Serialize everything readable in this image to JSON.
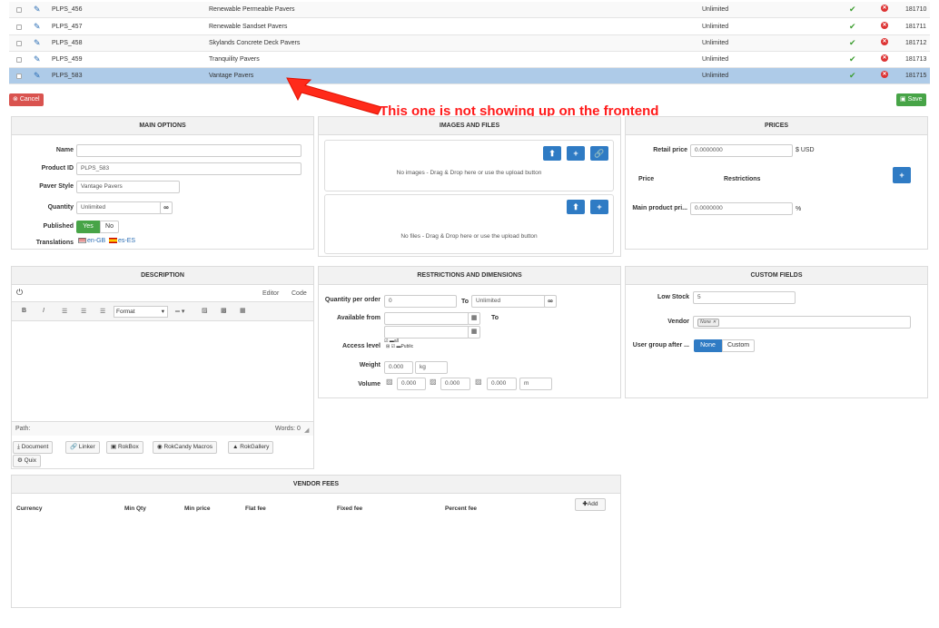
{
  "rows": [
    {
      "id": "PLPS_456",
      "name": "Renewable Permeable Pavers",
      "quantity": "Unlimited",
      "record": "181710"
    },
    {
      "id": "PLPS_457",
      "name": "Renewable Sandset Pavers",
      "quantity": "Unlimited",
      "record": "181711"
    },
    {
      "id": "PLPS_458",
      "name": "Skylands Concrete Deck Pavers",
      "quantity": "Unlimited",
      "record": "181712"
    },
    {
      "id": "PLPS_459",
      "name": "Tranquility Pavers",
      "quantity": "Unlimited",
      "record": "181713"
    },
    {
      "id": "PLPS_583",
      "name": "Vantage Pavers",
      "quantity": "Unlimited",
      "record": "181715"
    }
  ],
  "toolbar": {
    "cancel_label": "Cancel",
    "save_label": "Save"
  },
  "annotation": {
    "text": "This one is not showing up on the frontend",
    "color": "#ff1a1a"
  },
  "main_options": {
    "title": "MAIN OPTIONS",
    "name_label": "Name",
    "name_value": "",
    "product_id_label": "Product ID",
    "product_id_value": "PLPS_583",
    "style_label": "Paver Style",
    "style_value": "Vantage Pavers",
    "quantity_label": "Quantity",
    "quantity_value": "Unlimited",
    "published_label": "Published",
    "yes": "Yes",
    "no": "No",
    "translations_label": "Translations",
    "lang1": "en-GB",
    "lang2": "es-ES"
  },
  "images": {
    "title": "IMAGES AND FILES",
    "no_images": "No images - Drag & Drop here or use the upload button",
    "no_files": "No files - Drag & Drop here or use the upload button"
  },
  "prices": {
    "title": "PRICES",
    "retail_label": "Retail price",
    "retail_value": "0.0000000",
    "currency": "$ USD",
    "price_col": "Price",
    "restrictions_col": "Restrictions",
    "main_label": "Main product pri...",
    "main_value": "0.0000000",
    "percent": "%"
  },
  "description": {
    "title": "DESCRIPTION",
    "tab_editor": "Editor",
    "tab_code": "Code",
    "format_label": "Format",
    "path_label": "Path:",
    "words_label": "Words: 0",
    "buttons": [
      "Document",
      "Linker",
      "RokBox",
      "RokCandy Macros",
      "RokGallery",
      "Quix"
    ]
  },
  "restrictions": {
    "title": "RESTRICTIONS AND DIMENSIONS",
    "qpo_label": "Quantity per order",
    "qpo_from": "0",
    "to_label": "To",
    "qpo_to": "Unlimited",
    "avail_label": "Available from",
    "avail_to": "To",
    "access_label": "Access level",
    "access_all": "all",
    "access_public": "Public",
    "weight_label": "Weight",
    "weight_value": "0.000",
    "weight_unit": "kg",
    "volume_label": "Volume",
    "vol1": "0.000",
    "vol2": "0.000",
    "vol3": "0.000",
    "vol_unit": "m"
  },
  "custom": {
    "title": "CUSTOM FIELDS",
    "low_stock_label": "Low Stock",
    "low_stock_value": "5",
    "vendor_label": "Vendor",
    "vendor_tag": "None",
    "user_group_label": "User group after ...",
    "none_btn": "None",
    "custom_btn": "Custom"
  },
  "vendor_fees": {
    "title": "VENDOR FEES",
    "columns": [
      "Currency",
      "Min Qty",
      "Min price",
      "Flat fee",
      "Fixed fee",
      "Percent fee"
    ],
    "add_label": "Add"
  }
}
